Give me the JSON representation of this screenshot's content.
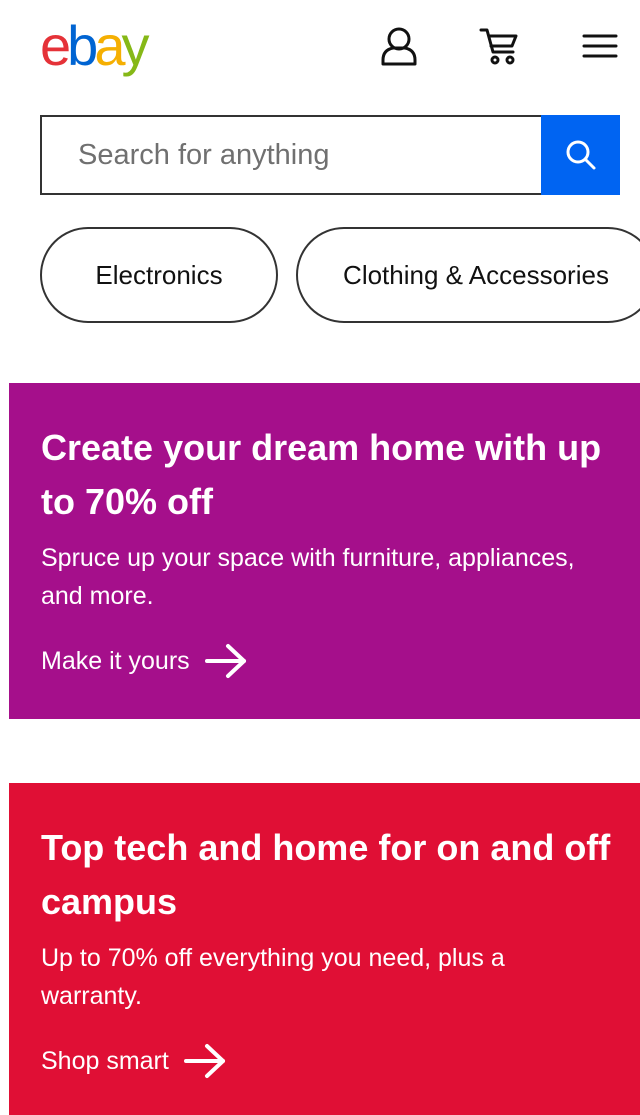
{
  "header": {
    "logo": {
      "letters": [
        "e",
        "b",
        "a",
        "y"
      ]
    },
    "colors": {
      "e": "#e53238",
      "b": "#0064d2",
      "a": "#f5af02",
      "y": "#86b817"
    },
    "icons": [
      "user-icon",
      "cart-icon",
      "menu-icon"
    ]
  },
  "search": {
    "placeholder": "Search for anything",
    "value": "",
    "button_color": "#0064f2",
    "icon": "search-icon"
  },
  "categories": [
    {
      "label": "Electronics"
    },
    {
      "label": "Clothing & Accessories"
    }
  ],
  "banners": [
    {
      "title": "Create your dream home with up to 70% off",
      "description": "Spruce up your space with furniture, appliances, and more.",
      "link": "Make it yours",
      "background": "#a50f8b"
    },
    {
      "title": "Top tech and home for on and off campus",
      "description": "Up to 70% off everything you need, plus a warranty.",
      "link": "Shop smart",
      "background": "#e00f35"
    }
  ]
}
